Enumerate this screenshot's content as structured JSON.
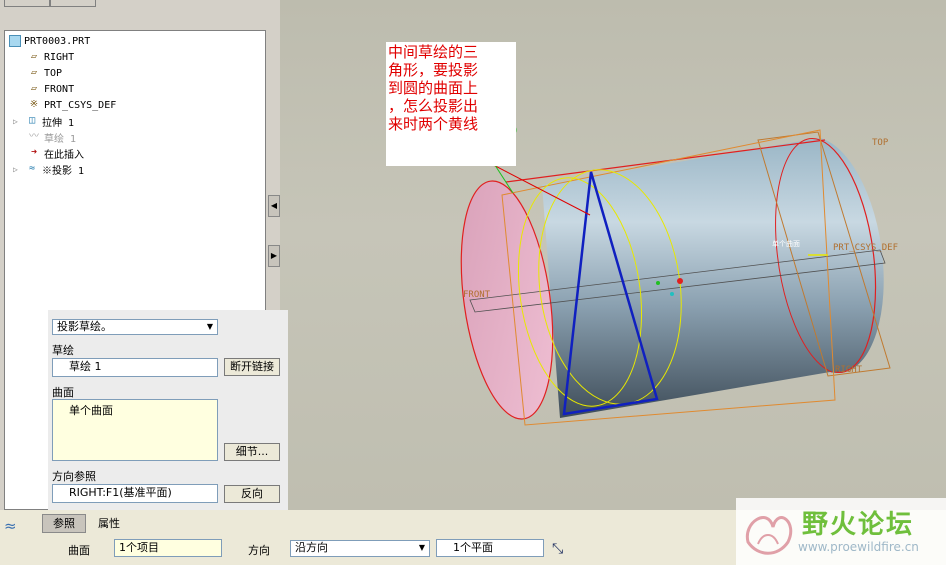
{
  "tree": {
    "items": [
      {
        "label": "PRT0003.PRT",
        "icon": "part-icon"
      },
      {
        "label": "RIGHT",
        "icon": "datum-plane-icon"
      },
      {
        "label": "TOP",
        "icon": "datum-plane-icon"
      },
      {
        "label": "FRONT",
        "icon": "datum-plane-icon"
      },
      {
        "label": "PRT_CSYS_DEF",
        "icon": "csys-icon"
      },
      {
        "label": "拉伸 1",
        "icon": "extrude-icon"
      },
      {
        "label": "草绘 1",
        "icon": "sketch-icon"
      },
      {
        "label": "在此插入",
        "icon": "insert-here-arrow-icon"
      },
      {
        "label": "※投影 1",
        "icon": "projection-icon"
      }
    ]
  },
  "dialog": {
    "type_select": "投影草绘。",
    "sketch_label": "草绘",
    "sketch_value": "草绘 1",
    "break_link_button": "断开链接",
    "surface_label": "曲面",
    "surface_value": "单个曲面",
    "details_button": "细节...",
    "direction_ref_label": "方向参照",
    "direction_ref_value": "RIGHT:F1(基准平面)",
    "flip_button": "反向"
  },
  "bottom": {
    "tab_references": "参照",
    "tab_properties": "属性",
    "surface_label": "曲面",
    "surface_value": "1个项目",
    "direction_label": "方向",
    "direction_select": "沿方向",
    "plane_value": "1个平面"
  },
  "annotation": {
    "line1": "中间草绘的三",
    "line2": "角形，要投影",
    "line3": "到圆的曲面上",
    "line4": "，怎么投影出",
    "line5": "来时两个黄线"
  },
  "viewport_labels": {
    "top": "TOP",
    "front": "FRONT",
    "right": "RIGHT",
    "csys": "PRT_CSYS_DEF",
    "csys_small": "单个曲面"
  },
  "watermark": {
    "title": "野火论坛",
    "url": "www.proewildfire.cn"
  },
  "colors": {
    "accent_red": "#e00000",
    "sketch_blue": "#1020c0",
    "projection_yellow": "#e8e800",
    "datum_orange": "#d08030",
    "watermark_green": "#6fbf3c"
  }
}
